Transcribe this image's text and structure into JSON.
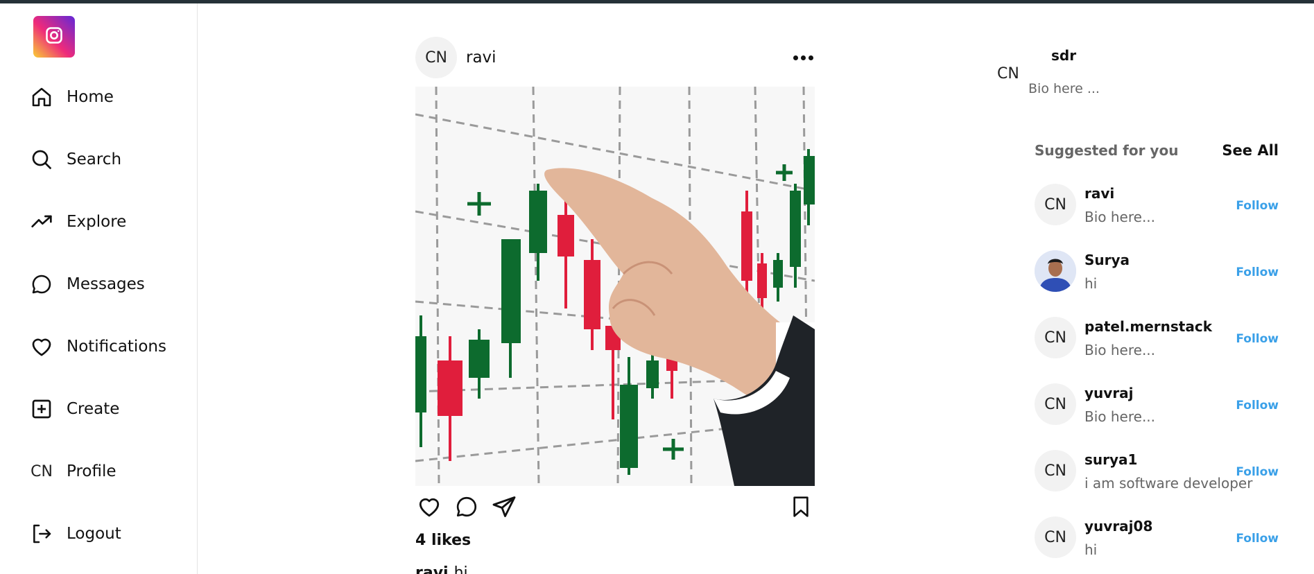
{
  "sidebar": {
    "logo_icon": "instagram-icon",
    "items": [
      {
        "label": "Home",
        "icon": "home-icon"
      },
      {
        "label": "Search",
        "icon": "search-icon"
      },
      {
        "label": "Explore",
        "icon": "trending-icon"
      },
      {
        "label": "Messages",
        "icon": "message-icon"
      },
      {
        "label": "Notifications",
        "icon": "heart-icon"
      },
      {
        "label": "Create",
        "icon": "plus-square-icon"
      },
      {
        "label": "Profile",
        "icon_text": "CN"
      },
      {
        "label": "Logout",
        "icon": "logout-icon"
      }
    ]
  },
  "post": {
    "avatar_text": "CN",
    "username": "ravi",
    "image": "candlestick-chart-hand-photo",
    "likes": "4 likes",
    "caption_user": "ravi",
    "caption_text": "hi"
  },
  "me": {
    "avatar_text": "CN",
    "username": "sdr",
    "bio": "Bio here ..."
  },
  "suggested": {
    "title": "Suggested for you",
    "see_all": "See All",
    "follow_label": "Follow",
    "items": [
      {
        "avatar_text": "CN",
        "name": "ravi",
        "bio": "Bio here..."
      },
      {
        "avatar_text": "",
        "name": "Surya",
        "bio": "hi"
      },
      {
        "avatar_text": "CN",
        "name": "patel.mernstack",
        "bio": "Bio here..."
      },
      {
        "avatar_text": "CN",
        "name": "yuvraj",
        "bio": "Bio here..."
      },
      {
        "avatar_text": "CN",
        "name": "surya1",
        "bio": "i am software developer"
      },
      {
        "avatar_text": "CN",
        "name": "yuvraj08",
        "bio": "hi"
      }
    ]
  },
  "colors": {
    "accent": "#3aa0e8",
    "topbar": "#263238",
    "muted": "#666666"
  }
}
